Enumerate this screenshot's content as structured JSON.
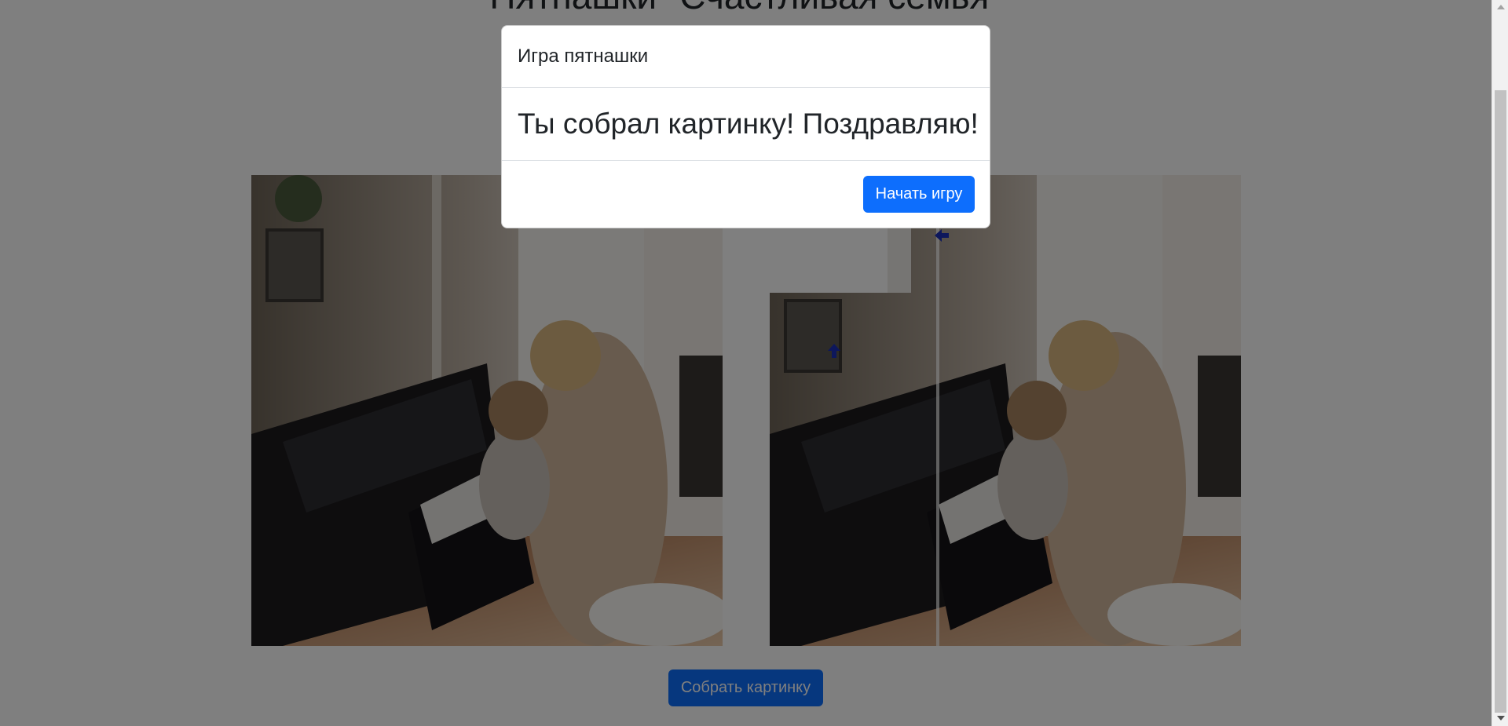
{
  "page": {
    "title": "Пятнашки \"Счастливая семья\""
  },
  "pictures": {
    "reference_alt": "reference-picture",
    "puzzle_alt": "puzzle-board"
  },
  "actions": {
    "assemble_label": "Собрать картинку"
  },
  "modal": {
    "title": "Игра пятнашки",
    "message": "Ты собрал картинку! Поздравляю!",
    "start_label": "Начать игру"
  },
  "colors": {
    "primary": "#0d6efd",
    "backdrop": "rgba(0,0,0,0.5)",
    "arrow": "#1a2fb8"
  },
  "icons": {
    "puzzle_arrows": [
      "arrow-up-icon",
      "arrow-left-icon"
    ]
  }
}
